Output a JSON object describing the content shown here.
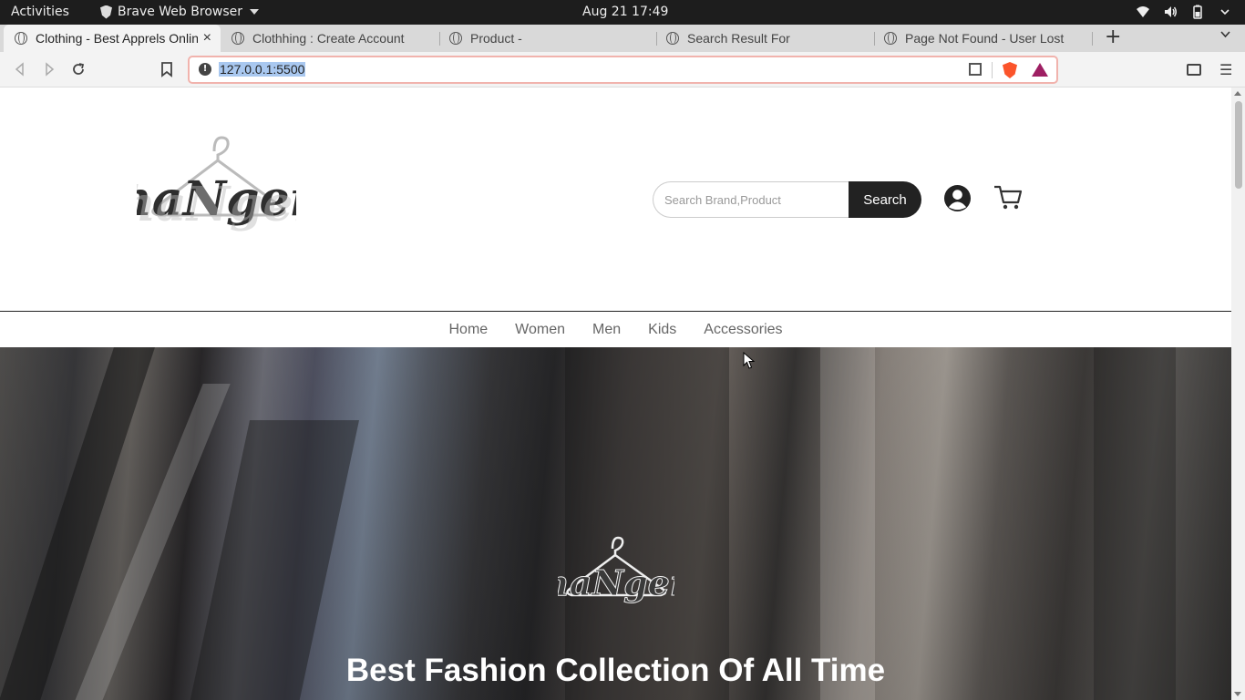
{
  "system": {
    "activities": "Activities",
    "app_name": "Brave Web Browser",
    "clock": "Aug 21  17:49"
  },
  "tabs": [
    {
      "title": "Clothing - Best Apprels Online",
      "active": true
    },
    {
      "title": "Clothhing : Create Account",
      "active": false
    },
    {
      "title": "Product -",
      "active": false
    },
    {
      "title": "Search Result For",
      "active": false
    },
    {
      "title": "Page Not Found - User Lost",
      "active": false
    }
  ],
  "toolbar": {
    "url": "127.0.0.1:5500",
    "icons": [
      "back-icon",
      "forward-icon",
      "reload-icon",
      "bookmark-icon",
      "site-info-icon",
      "qr-icon",
      "brave-shields-icon",
      "brave-rewards-icon",
      "wallet-icon",
      "menu-icon"
    ]
  },
  "header": {
    "brand": "haNger",
    "search": {
      "placeholder": "Search Brand,Product",
      "button_label": "Search"
    },
    "icons": [
      "user-icon",
      "cart-icon"
    ]
  },
  "nav": {
    "items": [
      "Home",
      "Women",
      "Men",
      "Kids",
      "Accessories"
    ]
  },
  "hero": {
    "brand": "haNger",
    "title": "Best Fashion Collection Of All Time"
  },
  "colors": {
    "search_button_bg": "#222222",
    "url_border": "#f1b3ad",
    "url_selection": "#a9c8f0",
    "brave_orange": "#fb542b",
    "rewards_purple": "#9e1f63"
  }
}
